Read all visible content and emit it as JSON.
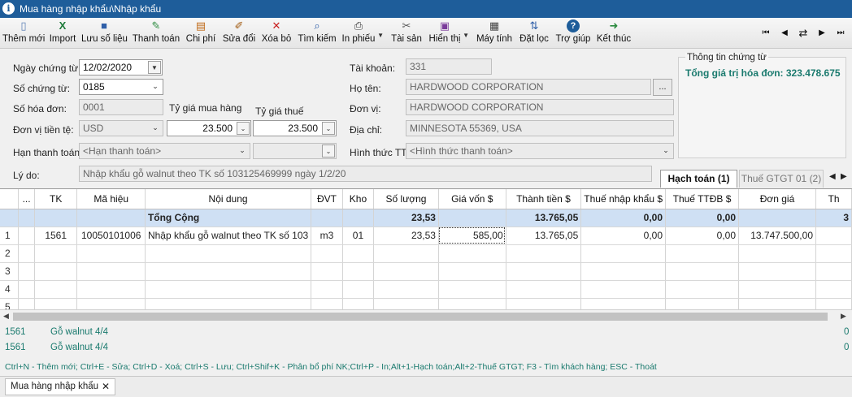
{
  "window": {
    "title": "Mua hàng nhập khẩu\\Nhập khẩu"
  },
  "toolbar": {
    "buttons": [
      {
        "label": "Thêm mới",
        "icon": "new-doc-icon",
        "glyph": "▯",
        "color": "#5a7fb5"
      },
      {
        "label": "Import",
        "icon": "excel-icon",
        "glyph": "X",
        "color": "#1e7b3a"
      },
      {
        "label": "Lưu số liệu",
        "icon": "save-icon",
        "glyph": "■",
        "color": "#2f5fa8"
      },
      {
        "label": "Thanh toán",
        "icon": "payment-icon",
        "glyph": "✎",
        "color": "#2b8a3e"
      },
      {
        "label": "Chi phí",
        "icon": "cost-icon",
        "glyph": "▤",
        "color": "#c06a18"
      },
      {
        "label": "Sửa đổi",
        "icon": "edit-icon",
        "glyph": "✐",
        "color": "#a05a10"
      },
      {
        "label": "Xóa bỏ",
        "icon": "delete-icon",
        "glyph": "✕",
        "color": "#c81e1e"
      },
      {
        "label": "Tìm kiếm",
        "icon": "search-icon",
        "glyph": "⌕",
        "color": "#2f5fa8"
      },
      {
        "label": "In phiếu",
        "icon": "print-icon",
        "glyph": "⎙",
        "color": "#333333"
      },
      {
        "label": "Tài sản",
        "icon": "tools-icon",
        "glyph": "✂",
        "color": "#555555"
      },
      {
        "label": "Hiển thị",
        "icon": "display-icon",
        "glyph": "▣",
        "color": "#7a3a9a"
      },
      {
        "label": "Máy tính",
        "icon": "calculator-icon",
        "glyph": "▦",
        "color": "#444444"
      },
      {
        "label": "Đặt lọc",
        "icon": "sort-filter-icon",
        "glyph": "⇅",
        "color": "#2f5fa8"
      },
      {
        "label": "Trợ giúp",
        "icon": "help-icon",
        "glyph": "?",
        "color": "#1e5d9a"
      },
      {
        "label": "Kết thúc",
        "icon": "exit-icon",
        "glyph": "➜",
        "color": "#2b8a3e"
      }
    ],
    "nav": [
      "⏮",
      "◀",
      "⇄",
      "▶",
      "⏭"
    ]
  },
  "form": {
    "ngay_ct": {
      "label": "Ngày chứng từ:",
      "value": "12/02/2020"
    },
    "so_ct": {
      "label": "Số chứng từ:",
      "value": "0185"
    },
    "so_hd": {
      "label": "Số hóa đơn:",
      "value": "0001"
    },
    "ty_gia_mua": {
      "label": "Tỷ giá mua hàng",
      "value": "23.500"
    },
    "ty_gia_thue": {
      "label": "Tỷ giá thuế",
      "value": "23.500"
    },
    "don_vi_tien": {
      "label": "Đơn vị tiền tệ:",
      "value": "USD"
    },
    "han_tt": {
      "label": "Hạn thanh toán:",
      "placeholder": "<Hạn thanh toán>"
    },
    "ly_do": {
      "label": "Lý do:",
      "value": "Nhập khẩu gỗ walnut theo TK số 103125469999 ngày 1/2/20"
    },
    "tai_khoan": {
      "label": "Tài khoản:",
      "value": "331"
    },
    "ho_ten": {
      "label": "Họ tên:",
      "value": "HARDWOOD CORPORATION"
    },
    "don_vi": {
      "label": "Đơn vị:",
      "value": "HARDWOOD CORPORATION"
    },
    "dia_chi": {
      "label": "Địa chỉ:",
      "value": "MINNESOTA 55369, USA"
    },
    "hinh_thuc_tt": {
      "label": "Hình thức TT",
      "placeholder": "<Hình thức thanh toán>"
    }
  },
  "info": {
    "title": "Thông tin chứng từ",
    "value": "Tổng giá trị hóa đơn: 323.478.675"
  },
  "tabs": [
    {
      "label": "Hạch toán (1)"
    },
    {
      "label": "Thuế GTGT 01 (2)"
    }
  ],
  "grid": {
    "columns": [
      "",
      "...",
      "TK",
      "Mã hiệu",
      "Nội dung",
      "ĐVT",
      "Kho",
      "Số lượng",
      "Giá vốn $",
      "Thành tiền $",
      "Thuế nhập khẩu $",
      "Thuế TTĐB $",
      "Đơn giá",
      "Th"
    ],
    "total": {
      "label": "Tổng Cộng",
      "so_luong": "23,53",
      "thanh_tien": "13.765,05",
      "thue_nk": "0,00",
      "thue_ttdb": "0,00",
      "tail": "3"
    },
    "rows": [
      {
        "n": "1",
        "tk": "1561",
        "ma": "10050101006",
        "nd": "Nhập khẩu gỗ walnut theo TK số 103",
        "dvt": "m3",
        "kho": "01",
        "sl": "23,53",
        "gv": "585,00",
        "tt": "13.765,05",
        "tnk": "0,00",
        "ttdb": "0,00",
        "dg": "13.747.500,00"
      },
      {
        "n": "2"
      },
      {
        "n": "3"
      },
      {
        "n": "4"
      },
      {
        "n": "5"
      }
    ]
  },
  "details": [
    {
      "tk": "1561",
      "desc": "Gỗ walnut 4/4",
      "val": "0"
    },
    {
      "tk": "1561",
      "desc": "Gỗ walnut 4/4",
      "val": "0"
    }
  ],
  "shortcuts": "Ctrl+N - Thêm mới; Ctrl+E - Sửa; Ctrl+D - Xoá; Ctrl+S - Lưu; Ctrl+Shif+K - Phân bổ phí NK;Ctrl+P - In;Alt+1-Hạch toán;Alt+2-Thuế GTGT; F3 - Tìm khách hàng; ESC - Thoát",
  "bottom_tab": {
    "label": "Mua hàng nhập khẩu",
    "close": "✕"
  }
}
